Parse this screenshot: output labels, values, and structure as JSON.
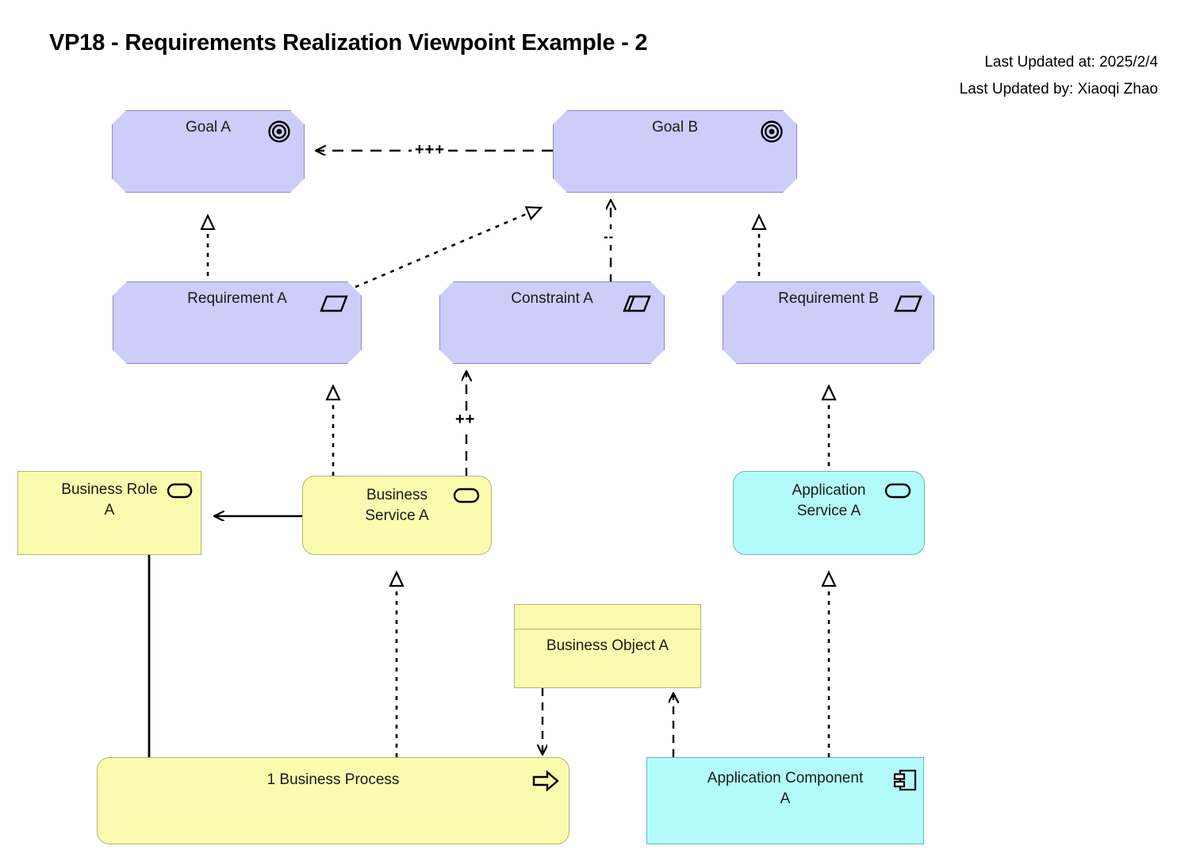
{
  "title": "VP18 - Requirements Realization Viewpoint Example - 2",
  "meta": {
    "updated_at": "Last Updated at: 2025/2/4",
    "updated_by": "Last Updated by: Xiaoqi Zhao"
  },
  "colors": {
    "motivation_fill": "#cccdf9",
    "motivation_stroke": "#8a8ab8",
    "business_fill": "#fbfbb0",
    "business_stroke": "#b6b66a",
    "application_fill": "#b3fbfb",
    "application_stroke": "#6ab6b6",
    "line": "#000000",
    "background": "#ffffff"
  },
  "nodes": {
    "goal_a": {
      "label": "Goal A",
      "icon": "goal-target-icon",
      "type": "goal"
    },
    "goal_b": {
      "label": "Goal B",
      "icon": "goal-target-icon",
      "type": "goal"
    },
    "requirement_a": {
      "label": "Requirement A",
      "icon": "requirement-parallelogram-icon",
      "type": "requirement"
    },
    "constraint_a": {
      "label": "Constraint A",
      "icon": "constraint-parallelogram-icon",
      "type": "constraint"
    },
    "requirement_b": {
      "label": "Requirement B",
      "icon": "requirement-parallelogram-icon",
      "type": "requirement"
    },
    "business_role_a": {
      "label": "Business Role\nA",
      "line1": "Business Role",
      "line2": "A",
      "icon": "business-role-icon",
      "type": "business-role"
    },
    "business_service_a": {
      "line1": "Business",
      "line2": "Service A",
      "icon": "service-rounded-icon",
      "type": "business-service"
    },
    "application_service_a": {
      "line1": "Application",
      "line2": "Service A",
      "icon": "service-rounded-icon",
      "type": "application-service"
    },
    "business_object_a": {
      "label": "Business Object A",
      "icon": "business-object-icon",
      "type": "business-object"
    },
    "business_process": {
      "label": "1 Business Process",
      "icon": "process-arrow-icon",
      "type": "business-process"
    },
    "application_component_a": {
      "line1": "Application Component",
      "line2": "A",
      "icon": "application-component-icon",
      "type": "application-component"
    }
  },
  "edges": [
    {
      "name": "goal-b-influences-goal-a",
      "from": "goal_b",
      "to": "goal_a",
      "style": "dashed",
      "arrow": "open",
      "label": "+++"
    },
    {
      "name": "requirement-a-realizes-goal-a",
      "from": "requirement_a",
      "to": "goal_a",
      "style": "dotted",
      "arrow": "hollow-triangle",
      "label": ""
    },
    {
      "name": "requirement-a-realizes-goal-b",
      "from": "requirement_a",
      "to": "goal_b",
      "style": "dotted",
      "arrow": "hollow-triangle",
      "label": ""
    },
    {
      "name": "constraint-a-influences-goal-b",
      "from": "constraint_a",
      "to": "goal_b",
      "style": "dashed",
      "arrow": "open",
      "label": "--"
    },
    {
      "name": "requirement-b-realizes-goal-b",
      "from": "requirement_b",
      "to": "goal_b",
      "style": "dotted",
      "arrow": "hollow-triangle",
      "label": ""
    },
    {
      "name": "business-service-a-realizes-requirement-a",
      "from": "business_service_a",
      "to": "requirement_a",
      "style": "dotted",
      "arrow": "hollow-triangle",
      "label": ""
    },
    {
      "name": "business-service-a-influences-constraint-a",
      "from": "business_service_a",
      "to": "constraint_a",
      "style": "dashed",
      "arrow": "open",
      "label": "++"
    },
    {
      "name": "application-service-a-realizes-requirement-b",
      "from": "application_service_a",
      "to": "requirement_b",
      "style": "dotted",
      "arrow": "hollow-triangle",
      "label": ""
    },
    {
      "name": "business-service-a-serves-business-role-a",
      "from": "business_service_a",
      "to": "business_role_a",
      "style": "solid",
      "arrow": "open",
      "label": ""
    },
    {
      "name": "business-process-realizes-business-service-a",
      "from": "business_process",
      "to": "business_service_a",
      "style": "dotted",
      "arrow": "hollow-triangle",
      "label": ""
    },
    {
      "name": "business-role-a-assigned-business-process",
      "from": "business_role_a",
      "to": "business_process",
      "style": "solid",
      "arrow": "none",
      "label": ""
    },
    {
      "name": "business-process-accesses-business-object-a",
      "from": "business_object_a",
      "to": "business_process",
      "style": "dashed",
      "arrow": "open",
      "label": ""
    },
    {
      "name": "application-component-a-accesses-business-object-a",
      "from": "application_component_a",
      "to": "business_object_a",
      "style": "dashed",
      "arrow": "open",
      "label": ""
    },
    {
      "name": "application-component-a-realizes-application-service-a",
      "from": "application_component_a",
      "to": "application_service_a",
      "style": "dotted",
      "arrow": "hollow-triangle",
      "label": ""
    }
  ]
}
